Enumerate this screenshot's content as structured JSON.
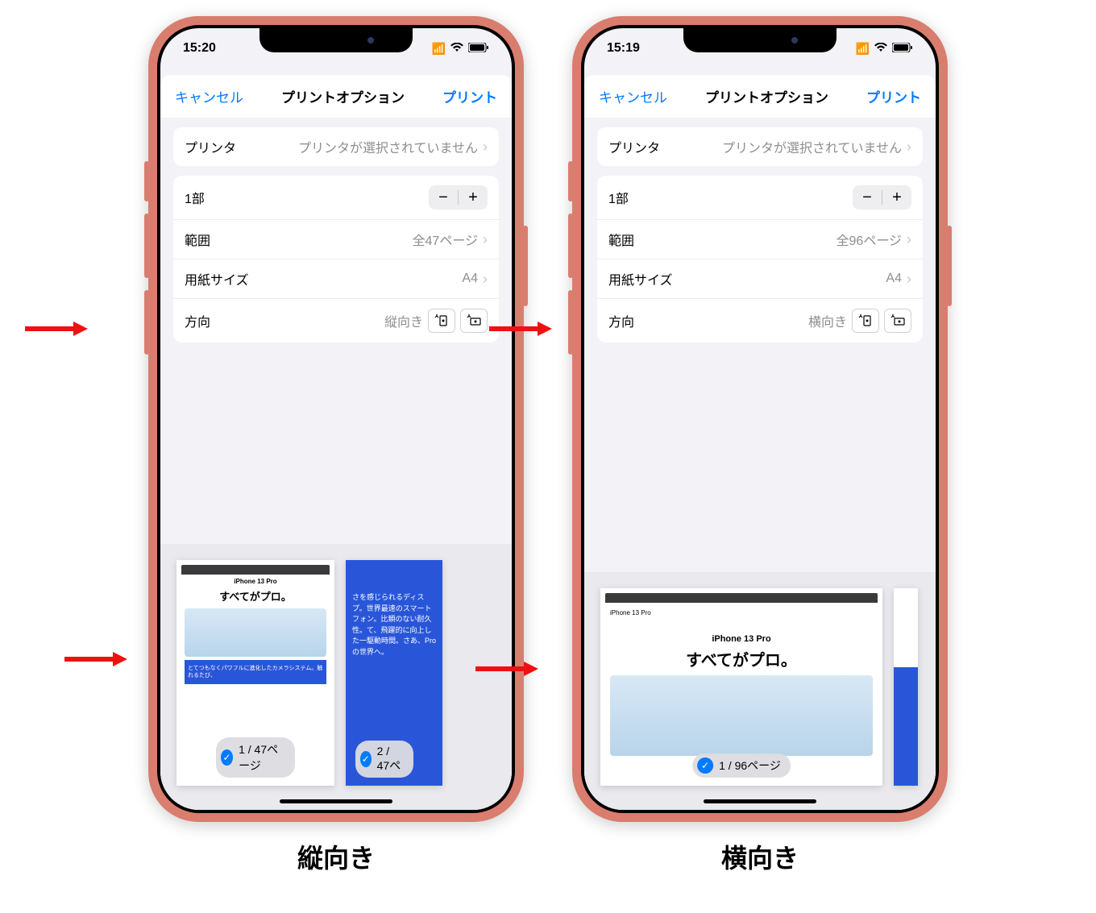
{
  "phones": [
    {
      "time": "15:20",
      "cancel": "キャンセル",
      "title": "プリントオプション",
      "print": "プリント",
      "printer_label": "プリンタ",
      "printer_value": "プリンタが選択されていません",
      "copies": "1部",
      "range_label": "範囲",
      "range_value": "全47ページ",
      "paper_label": "用紙サイズ",
      "paper_value": "A4",
      "orient_label": "方向",
      "orient_value": "縦向き",
      "thumb_product": "iPhone 13 Pro",
      "thumb_tagline": "すべてがプロ。",
      "thumb_blue1": "とてつもなくパワフルに進化したカメラシステム。触れるたび、",
      "thumb2_text": "さを感じられるディスプ。世界最速のスマートフォン。比類のない耐久性。て、飛躍的に向上した一駆動時間。さあ、Proの世界へ。",
      "page1_badge": "1 / 47ページ",
      "page2_badge": "2 / 47ペ",
      "caption": "縦向き"
    },
    {
      "time": "15:19",
      "cancel": "キャンセル",
      "title": "プリントオプション",
      "print": "プリント",
      "printer_label": "プリンタ",
      "printer_value": "プリンタが選択されていません",
      "copies": "1部",
      "range_label": "範囲",
      "range_value": "全96ページ",
      "paper_label": "用紙サイズ",
      "paper_value": "A4",
      "orient_label": "方向",
      "orient_value": "横向き",
      "thumb_product": "iPhone 13 Pro",
      "thumb_tagline": "すべてがプロ。",
      "page1_badge": "1 / 96ページ",
      "caption": "横向き"
    }
  ],
  "icons": {
    "minus": "−",
    "plus": "+",
    "check": "✓",
    "chevron": "›"
  }
}
